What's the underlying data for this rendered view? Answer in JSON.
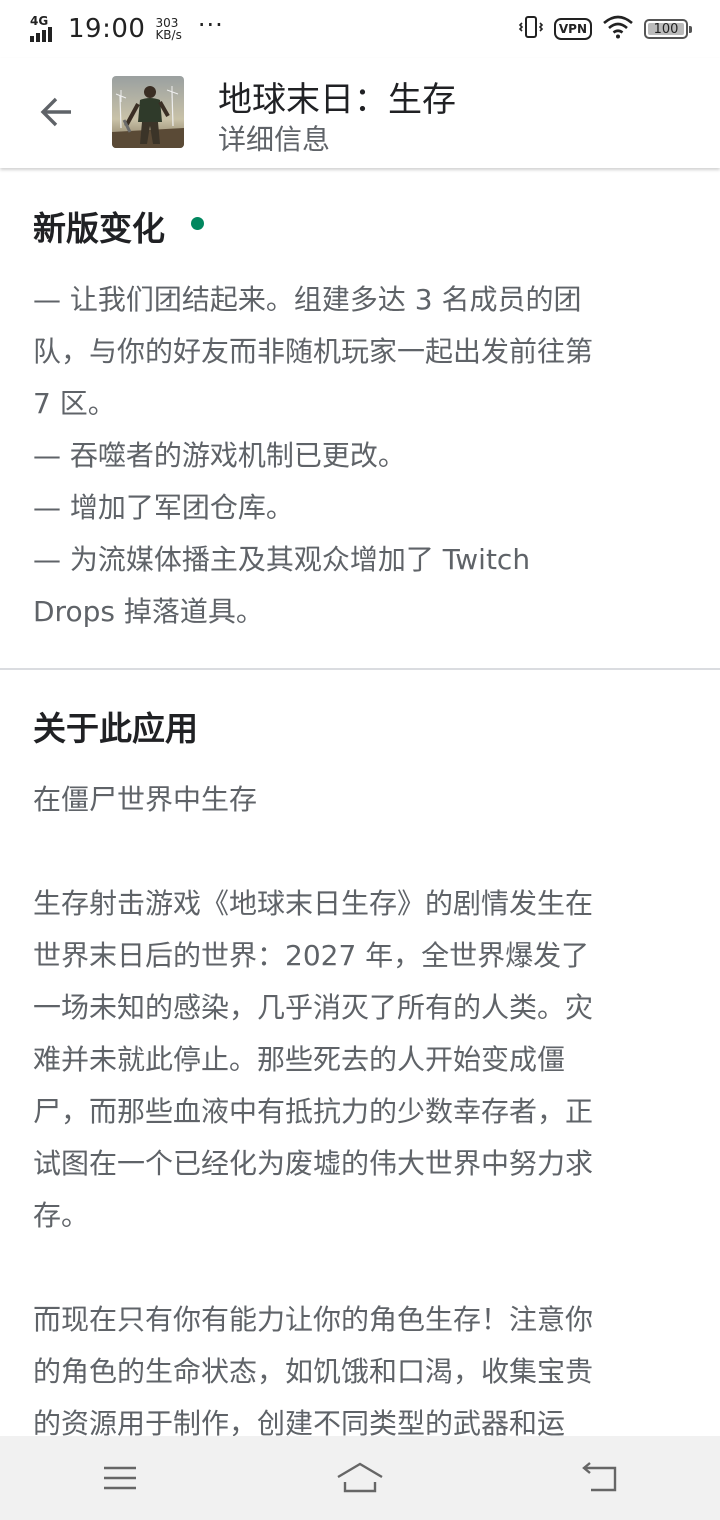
{
  "status_bar": {
    "network": "4G",
    "time": "19:00",
    "speed_value": "303",
    "speed_unit": "KB/s",
    "more": "···",
    "vpn": "VPN",
    "battery": "100"
  },
  "app_bar": {
    "title": "地球末日：生存",
    "subtitle": "详细信息"
  },
  "whats_new": {
    "title": "新版变化",
    "dot_color": "#01875f",
    "lines": [
      "— 让我们团结起来。组建多达 3 名成员的团",
      "队，与你的好友而非随机玩家一起出发前往第",
      "7 区。",
      "— 吞噬者的游戏机制已更改。",
      "— 增加了军团仓库。",
      "— 为流媒体播主及其观众增加了 Twitch",
      "Drops 掉落道具。"
    ]
  },
  "about": {
    "title": "关于此应用",
    "tagline": "在僵尸世界中生存",
    "paragraph1": [
      "生存射击游戏《地球末日生存》的剧情发生在",
      "世界末日后的世界：2027 年，全世界爆发了",
      "一场未知的感染，几乎消灭了所有的人类。灾",
      "难并未就此停止。那些死去的人开始变成僵",
      "尸，而那些血液中有抵抗力的少数幸存者，正",
      "试图在一个已经化为废墟的伟大世界中努力求",
      "存。"
    ],
    "paragraph2": [
      "而现在只有你有能力让你的角色生存！注意你",
      "的角色的生命状态，如饥饿和口渴，收集宝贵",
      "的资源用于制作，创建不同类型的武器和运"
    ]
  },
  "nav_bar": {
    "menu_icon": "menu-icon",
    "home_icon": "home-icon",
    "back_icon": "back-icon"
  }
}
